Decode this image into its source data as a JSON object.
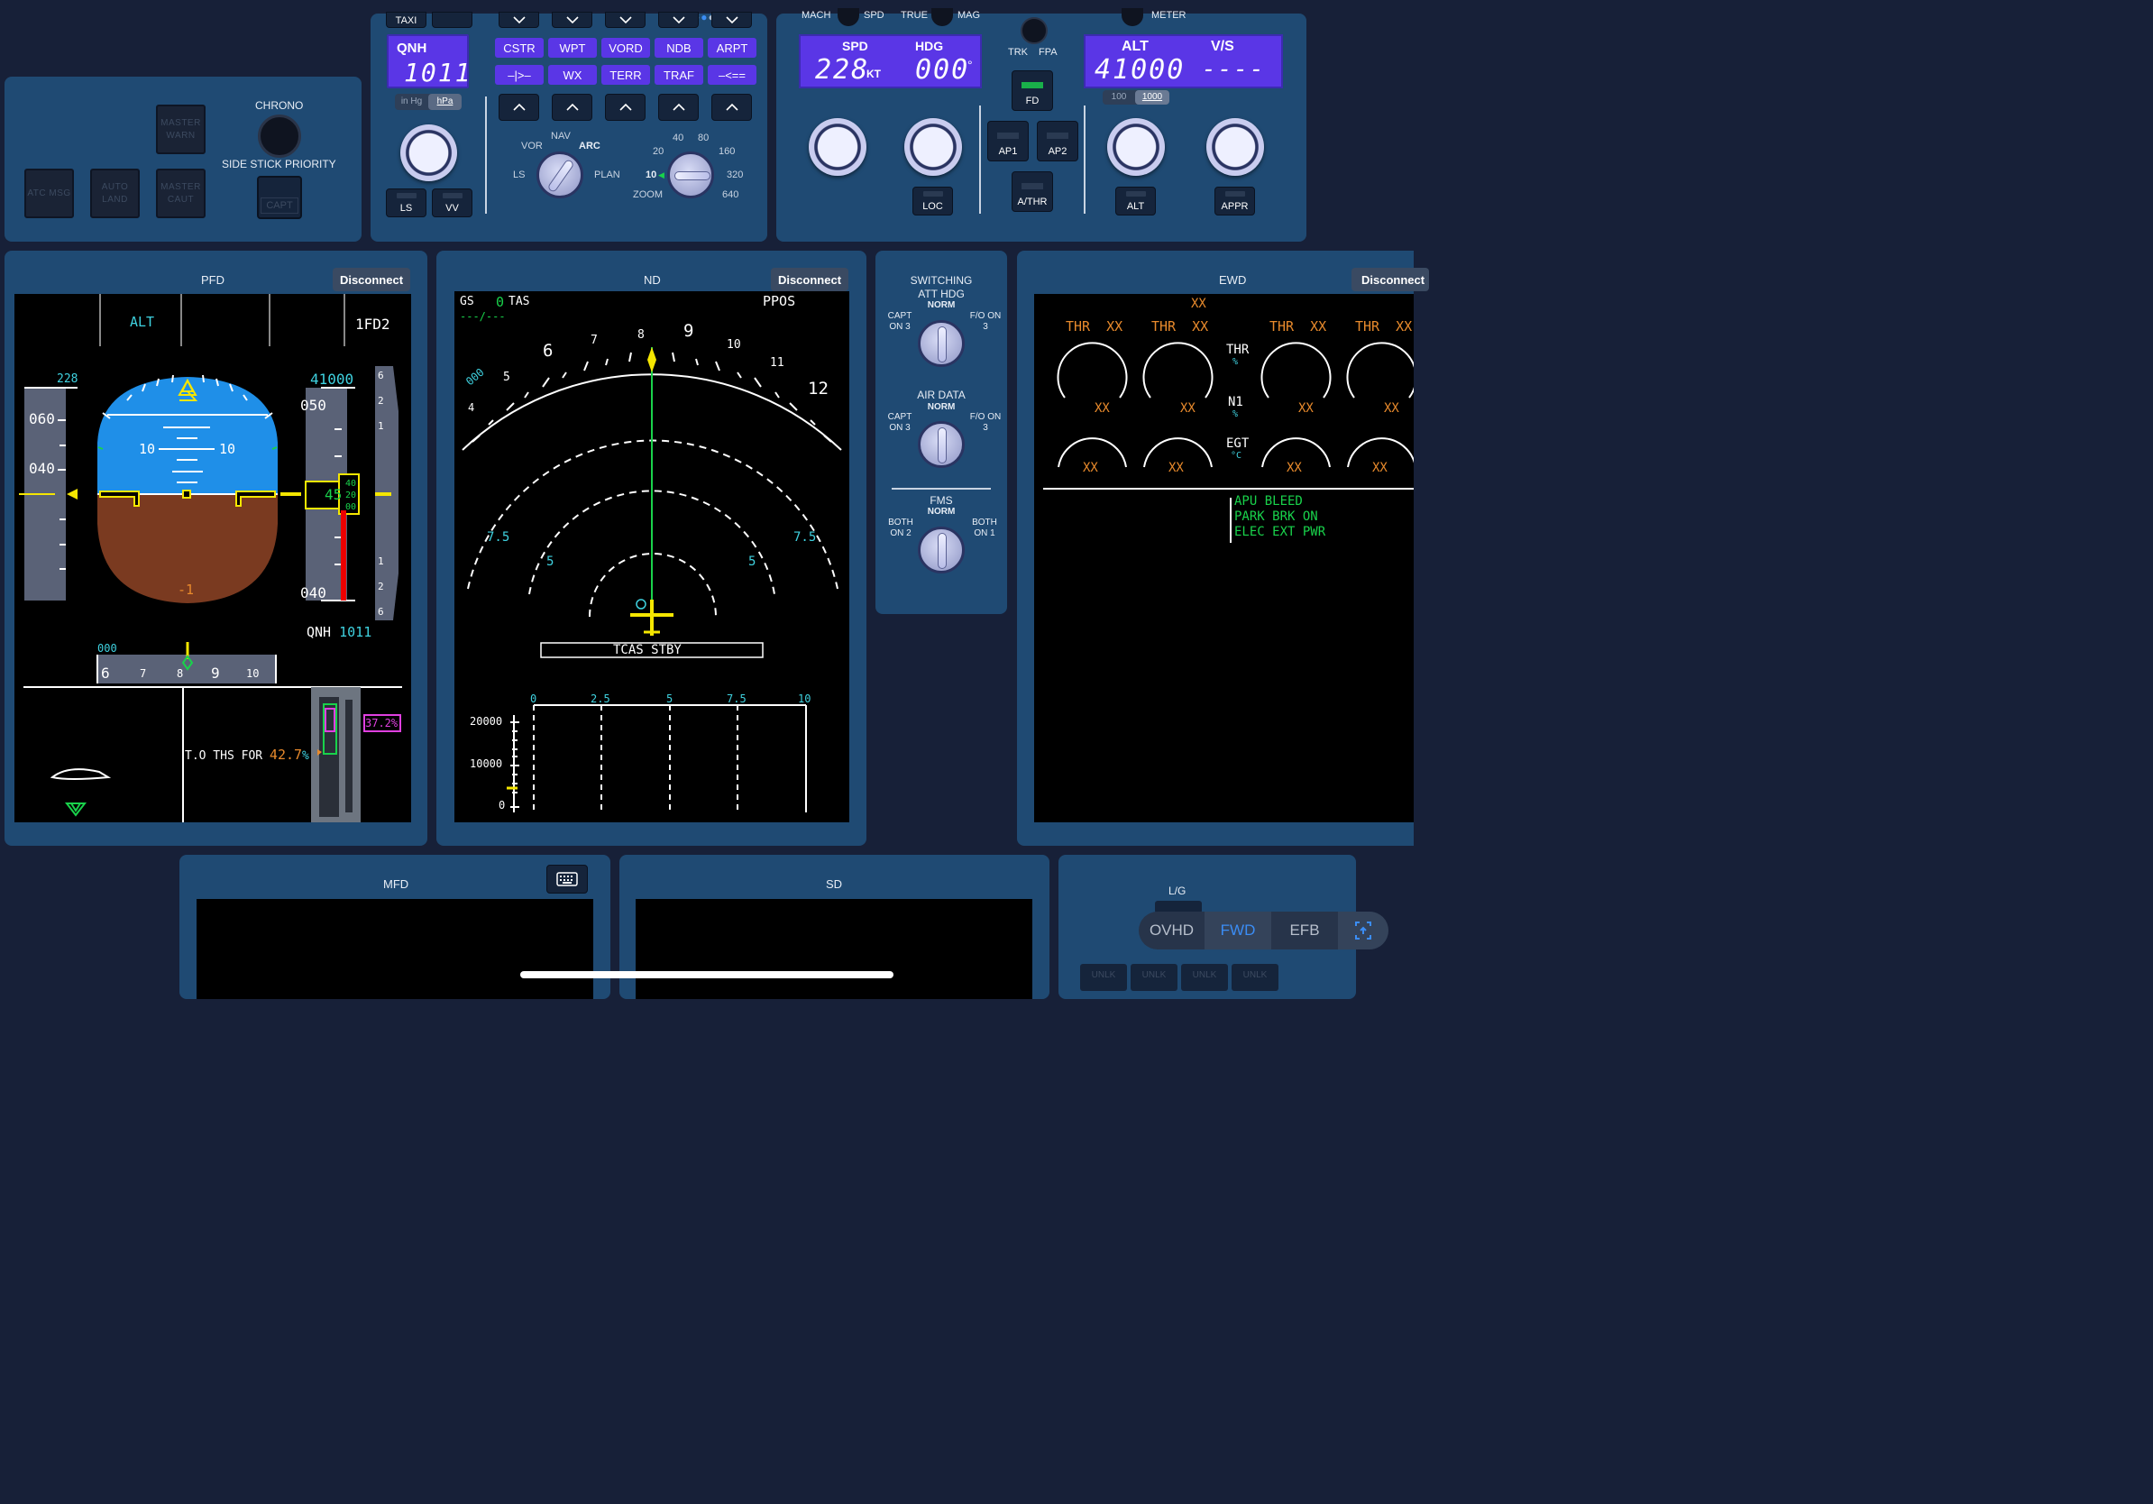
{
  "glareshield": {
    "chrono_label": "CHRONO",
    "side_stick_label": "SIDE STICK PRIORITY",
    "capt_label": "CAPT",
    "master_warn": "MASTER WARN",
    "master_caut": "MASTER CAUT",
    "atc_msg": "ATC MSG",
    "auto_land": "AUTO LAND"
  },
  "efis": {
    "taxi_label": "TAXI",
    "qnh_label": "QNH",
    "qnh_value": "1011",
    "unit_inhg": "in Hg",
    "unit_hpa": "hPa",
    "buttons_row1": [
      "CSTR",
      "WPT",
      "VORD",
      "NDB",
      "ARPT"
    ],
    "buttons_row2": [
      "–|>–",
      "WX",
      "TERR",
      "TRAF",
      "–<=="
    ],
    "ls_label": "LS",
    "vv_label": "VV",
    "mode_labels": {
      "vor": "VOR",
      "nav": "NAV",
      "arc": "ARC",
      "ls": "LS",
      "plan": "PLAN"
    },
    "range_labels": [
      "10",
      "20",
      "40",
      "80",
      "160",
      "320",
      "640"
    ],
    "zoom_label": "ZOOM"
  },
  "fcu": {
    "mach_label": "MACH",
    "spd_label": "SPD",
    "true_label": "TRUE",
    "mag_label": "MAG",
    "meter_label": "METER",
    "spd_title": "SPD",
    "spd_value": "228",
    "spd_unit": "KT",
    "hdg_title": "HDG",
    "hdg_value": "000",
    "hdg_unit": "°",
    "trk_label": "TRK",
    "fpa_label": "FPA",
    "fd_label": "FD",
    "alt_title": "ALT",
    "alt_value": "41000",
    "vs_title": "V/S",
    "vs_value": "----",
    "alt_inc_100": "100",
    "alt_inc_1000": "1000",
    "ap1": "AP1",
    "ap2": "AP2",
    "athr": "A/THR",
    "loc": "LOC",
    "alt_btn": "ALT",
    "appr": "APPR"
  },
  "pfd": {
    "title": "PFD",
    "disconnect": "Disconnect",
    "fma_alt": "ALT",
    "fma_fd": "1FD2",
    "speed_target": "228",
    "speed_ticks": [
      "060",
      "040"
    ],
    "pitch_10_left": "10",
    "pitch_10_right": "10",
    "roll_minus": "-1",
    "alt_target": "41000",
    "alt_ticks_top": "050",
    "alt_current": "45",
    "alt_ticks_bottom": "040",
    "alt_drum": [
      "40",
      "20",
      "00"
    ],
    "qnh_label": "QNH",
    "qnh_value": "1011",
    "hdg_ref": "000",
    "heading_ticks": [
      "6",
      "7",
      "8",
      "9",
      "10"
    ],
    "vs_ticks": [
      "6",
      "2",
      "1",
      "1",
      "2",
      "6"
    ],
    "ths_label": "T.O THS FOR",
    "ths_value": "42.7",
    "ths_unit": "%",
    "trim_pct": "37.2%"
  },
  "nd": {
    "title": "ND",
    "disconnect": "Disconnect",
    "gs_label": "GS",
    "gs_value": "0",
    "tas_label": "TAS",
    "wind": "---/---",
    "ppos": "PPOS",
    "compass": [
      "4",
      "5",
      "6",
      "7",
      "8",
      "9",
      "10",
      "11",
      "12"
    ],
    "track_ref": "000",
    "range_outer": "7.5",
    "range_inner": "5",
    "tcas": "TCAS STBY",
    "vd_x_ticks": [
      "0",
      "2.5",
      "5",
      "7.5",
      "10"
    ],
    "vd_y_ticks": [
      "20000",
      "10000",
      "0"
    ]
  },
  "switching": {
    "title": "SWITCHING",
    "att_hdg": "ATT HDG",
    "norm": "NORM",
    "capt_on3": "CAPT ON 3",
    "fo_on3": "F/O ON 3",
    "air_data": "AIR DATA",
    "fms": "FMS",
    "both_on2": "BOTH ON 2",
    "both_on1": "BOTH ON 1"
  },
  "ewd": {
    "title": "EWD",
    "disconnect": "Disconnect",
    "xx": "XX",
    "thr": "THR",
    "thr_unit": "%",
    "n1": "N1",
    "n1_unit": "%",
    "egt": "EGT",
    "egt_unit": "°C",
    "thr_xx": "THR  XX",
    "memo": [
      "APU BLEED",
      "PARK BRK ON",
      "ELEC EXT PWR"
    ]
  },
  "bottom": {
    "mfd_title": "MFD",
    "sd_title": "SD",
    "lg_label": "L/G",
    "unlk": "UNLK"
  },
  "tabs": {
    "ovhd": "OVHD",
    "fwd": "FWD",
    "efb": "EFB"
  },
  "colors": {
    "panel": "#1f4a73",
    "background": "#172038",
    "lcd": "#5a36e6",
    "pfd_cyan": "#3fd2e0",
    "pfd_green": "#19d24b",
    "amber": "#e88a2c",
    "magenta": "#e040e0",
    "active_tab": "#3b8df5"
  }
}
